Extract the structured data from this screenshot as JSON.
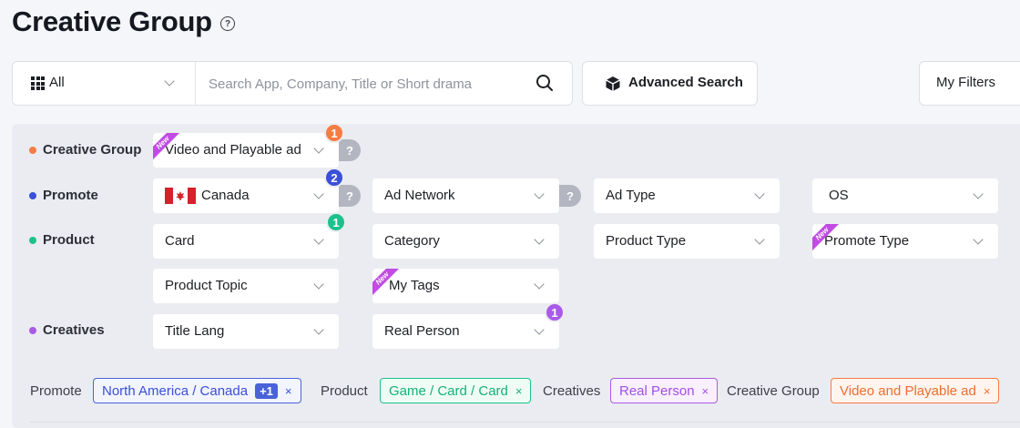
{
  "page": {
    "title": "Creative Group",
    "help_icon": "?"
  },
  "search": {
    "category_label": "All",
    "placeholder": "Search App, Company, Title or Short drama",
    "advanced_label": "Advanced Search",
    "my_filters_label": "My Filters"
  },
  "filters": {
    "new_ribbon": "New",
    "help_badge": "?",
    "rows": {
      "creative_group": {
        "label": "Creative Group",
        "color": "#f57c42"
      },
      "promote": {
        "label": "Promote",
        "color": "#3b4fd8"
      },
      "product": {
        "label": "Product",
        "color": "#1bc28b"
      },
      "creatives": {
        "label": "Creatives",
        "color": "#a95be8"
      }
    },
    "dropdowns": {
      "creative_group": "Video and Playable ad",
      "country": "Canada",
      "ad_network": "Ad Network",
      "ad_type": "Ad Type",
      "os": "OS",
      "card": "Card",
      "category": "Category",
      "product_type": "Product Type",
      "promote_type": "Promote Type",
      "product_topic": "Product Topic",
      "my_tags": "My Tags",
      "title_lang": "Title Lang",
      "real_person": "Real Person"
    },
    "counts": {
      "creative_group": "1",
      "country": "2",
      "card": "1",
      "real_person": "1"
    }
  },
  "applied": {
    "promote_label": "Promote",
    "promote_value": "North America / Canada",
    "promote_more": "+1",
    "product_label": "Product",
    "product_value": "Game / Card / Card",
    "creatives_label": "Creatives",
    "creatives_value": "Real Person",
    "group_label": "Creative Group",
    "group_value": "Video and Playable ad",
    "remove_symbol": "×"
  },
  "colors": {
    "orange": "#f57c42",
    "blue": "#3b4fd8",
    "green": "#1bc28b",
    "purple": "#a95be8",
    "ribbon": "#c14be3"
  }
}
